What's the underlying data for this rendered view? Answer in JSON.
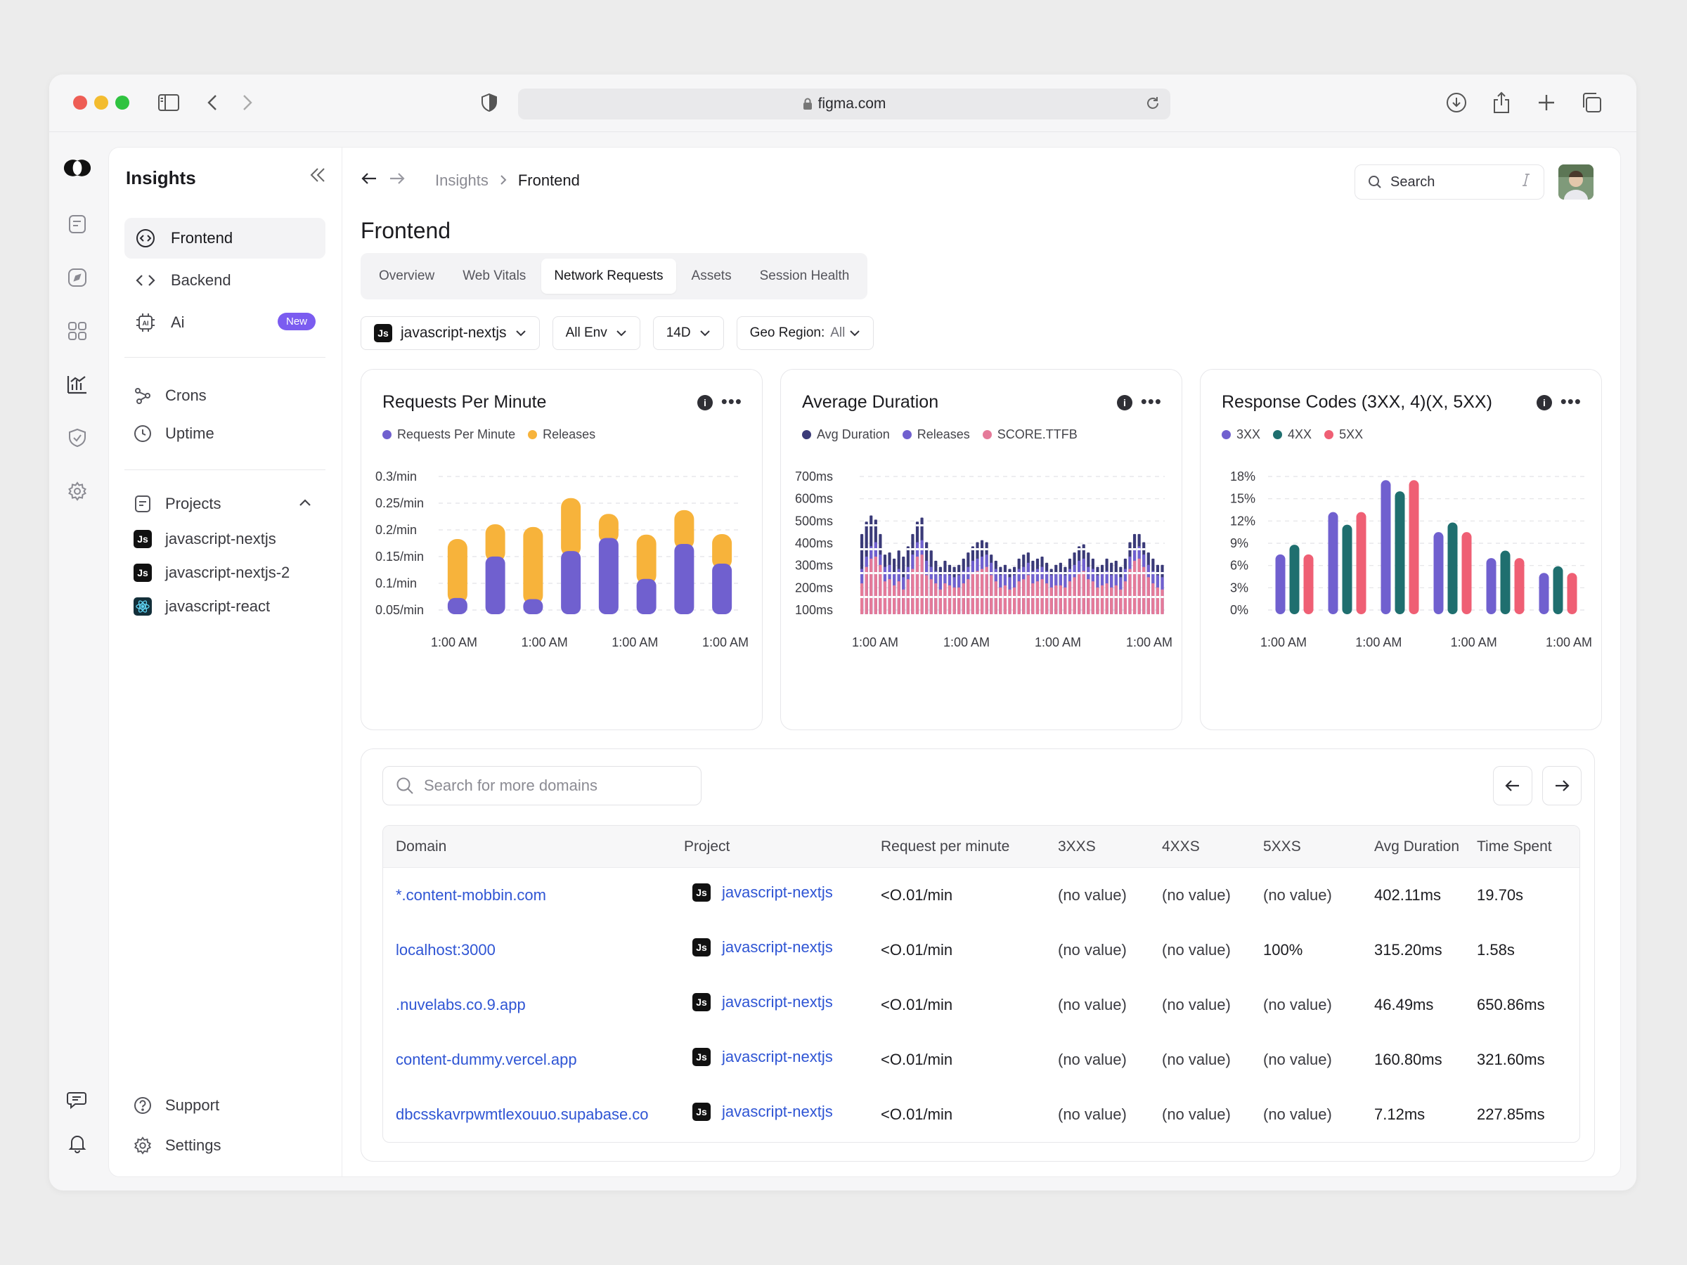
{
  "browser": {
    "url": "figma.com"
  },
  "sidebar": {
    "title": "Insights",
    "nav": [
      {
        "label": "Frontend",
        "icon": "code-circle-icon"
      },
      {
        "label": "Backend",
        "icon": "code-icon"
      },
      {
        "label": "Ai",
        "icon": "ai-chip-icon",
        "badge": "New"
      }
    ],
    "tools": [
      {
        "label": "Crons",
        "icon": "crons-icon"
      },
      {
        "label": "Uptime",
        "icon": "clock-icon"
      }
    ],
    "projects_label": "Projects",
    "projects": [
      "javascript-nextjs",
      "javascript-nextjs-2",
      "javascript-react"
    ],
    "footer": [
      {
        "label": "Support",
        "icon": "help-icon"
      },
      {
        "label": "Settings",
        "icon": "gear-icon"
      }
    ]
  },
  "header": {
    "breadcrumb": [
      "Insights",
      "Frontend"
    ],
    "search_placeholder": "Search",
    "page_title": "Frontend",
    "tabs": [
      "Overview",
      "Web Vitals",
      "Network Requests",
      "Assets",
      "Session Health"
    ],
    "active_tab": "Network Requests"
  },
  "filters": {
    "project_badge": "Js",
    "project": "javascript-nextjs",
    "env": "All Env",
    "range": "14D",
    "geo_label": "Geo Region:",
    "geo_value": "All"
  },
  "charts": {
    "rpm": {
      "title": "Requests Per Minute",
      "legend": [
        "Requests Per Minute",
        "Releases"
      ]
    },
    "avg": {
      "title": "Average Duration",
      "legend": [
        "Avg Duration",
        "Releases",
        "SCORE.TTFB"
      ]
    },
    "codes": {
      "title": "Response Codes (3XX, 4)(X, 5XX)",
      "legend": [
        "3XX",
        "4XX",
        "5XX"
      ]
    }
  },
  "colors": {
    "purple": "#7060cf",
    "orange": "#f7b33b",
    "navy": "#3a3a78",
    "pink": "#e57a99",
    "teal": "#1f6f6f",
    "red": "#ef5f74",
    "link": "#2f55d4"
  },
  "chart_data": [
    {
      "type": "bar",
      "title": "Requests Per Minute",
      "stacked": true,
      "categories": [
        "1:00 AM",
        "1:00 AM",
        "1:00 AM",
        "1:00 AM",
        "1:00 AM",
        "1:00 AM",
        "1:00 AM",
        "1:00 AM"
      ],
      "x_tick_labels": [
        "1:00 AM",
        "1:00 AM",
        "1:00 AM",
        "1:00 AM"
      ],
      "y_tick_labels": [
        "0.3/min",
        "0.25/min",
        "0.2/min",
        "0.15/min",
        "0.1/min",
        "0.05/min"
      ],
      "ylim": [
        0.05,
        0.3
      ],
      "series": [
        {
          "name": "Requests Per Minute",
          "values": [
            0.062,
            0.138,
            0.06,
            0.148,
            0.172,
            0.097,
            0.161,
            0.125
          ]
        },
        {
          "name": "Releases",
          "values": [
            0.17,
            0.197,
            0.192,
            0.245,
            0.216,
            0.178,
            0.223,
            0.179
          ]
        }
      ]
    },
    {
      "type": "bar",
      "title": "Average Duration",
      "x_tick_labels": [
        "1:00 AM",
        "1:00 AM",
        "1:00 AM",
        "1:00 AM"
      ],
      "y_tick_labels": [
        "700ms",
        "600ms",
        "500ms",
        "400ms",
        "300ms",
        "200ms",
        "100ms"
      ],
      "ylim": [
        100,
        700
      ],
      "series": [
        {
          "name": "Avg Duration",
          "values": [
            180,
            260,
            300,
            310,
            270,
            190,
            200,
            170,
            190,
            150,
            200,
            250,
            310,
            320,
            220,
            200,
            180,
            150,
            180,
            170,
            160,
            160,
            180,
            200,
            230,
            240,
            250,
            260,
            220,
            190,
            160,
            170,
            150,
            160,
            190,
            200,
            220,
            180,
            190,
            200,
            180,
            160,
            170,
            170,
            160,
            190,
            210,
            230,
            240,
            200,
            190,
            160,
            170,
            180,
            160,
            170,
            150,
            190,
            250,
            290,
            300,
            260,
            210,
            180,
            160,
            150
          ]
        },
        {
          "name": "Releases",
          "values": [
            250,
            310,
            360,
            380,
            320,
            260,
            270,
            230,
            250,
            210,
            260,
            320,
            380,
            390,
            290,
            260,
            240,
            220,
            230,
            220,
            210,
            220,
            240,
            260,
            290,
            300,
            310,
            320,
            280,
            250,
            220,
            230,
            210,
            220,
            250,
            260,
            280,
            240,
            250,
            260,
            240,
            220,
            230,
            230,
            220,
            250,
            270,
            290,
            300,
            260,
            250,
            220,
            230,
            240,
            220,
            230,
            210,
            250,
            310,
            350,
            360,
            320,
            270,
            240,
            220,
            210
          ]
        },
        {
          "name": "SCORE.TTFB",
          "values": [
            420,
            480,
            510,
            490,
            420,
            320,
            330,
            300,
            340,
            310,
            360,
            420,
            480,
            500,
            380,
            340,
            290,
            260,
            290,
            270,
            260,
            270,
            300,
            330,
            360,
            380,
            390,
            380,
            320,
            290,
            260,
            270,
            250,
            260,
            300,
            320,
            330,
            290,
            300,
            310,
            280,
            250,
            270,
            280,
            260,
            300,
            330,
            360,
            370,
            330,
            300,
            260,
            270,
            300,
            280,
            290,
            260,
            300,
            380,
            420,
            420,
            380,
            330,
            300,
            270,
            270
          ]
        }
      ]
    },
    {
      "type": "bar",
      "title": "Response Codes (3XX, 4)(X, 5XX)",
      "categories": [
        "1:00 AM",
        "1:00 AM",
        "1:00 AM",
        "1:00 AM",
        "1:00 AM",
        "1:00 AM"
      ],
      "x_tick_labels": [
        "1:00 AM",
        "1:00 AM",
        "1:00 AM",
        "1:00 AM"
      ],
      "y_tick_labels": [
        "18%",
        "15%",
        "12%",
        "9%",
        "6%",
        "3%",
        "0%"
      ],
      "ylim": [
        0,
        18
      ],
      "series": [
        {
          "name": "3XX",
          "values": [
            7.5,
            13.2,
            17.5,
            10.5,
            7.0,
            5.0
          ]
        },
        {
          "name": "4XX",
          "values": [
            8.8,
            11.5,
            16.0,
            11.8,
            8.0,
            5.9
          ]
        },
        {
          "name": "5XX",
          "values": [
            7.5,
            13.2,
            17.5,
            10.5,
            7.0,
            5.0
          ]
        }
      ]
    }
  ],
  "table": {
    "search_placeholder": "Search for more domains",
    "columns": [
      "Domain",
      "Project",
      "Request per minute",
      "3XXS",
      "4XXS",
      "5XXS",
      "Avg Duration",
      "Time Spent"
    ],
    "rows": [
      {
        "domain": "*.content-mobbin.com",
        "project": "javascript-nextjs",
        "rpm": "<O.01/min",
        "c3": "(no value)",
        "c4": "(no value)",
        "c5": "(no value)",
        "avg": "402.11ms",
        "time": "19.70s"
      },
      {
        "domain": "localhost:3000",
        "project": "javascript-nextjs",
        "rpm": "<O.01/min",
        "c3": "(no value)",
        "c4": "(no value)",
        "c5": "100%",
        "avg": "315.20ms",
        "time": "1.58s"
      },
      {
        "domain": ".nuvelabs.co.9.app",
        "project": "javascript-nextjs",
        "rpm": "<O.01/min",
        "c3": "(no value)",
        "c4": "(no value)",
        "c5": "(no value)",
        "avg": "46.49ms",
        "time": "650.86ms"
      },
      {
        "domain": "content-dummy.vercel.app",
        "project": "javascript-nextjs",
        "rpm": "<O.01/min",
        "c3": "(no value)",
        "c4": "(no value)",
        "c5": "(no value)",
        "avg": "160.80ms",
        "time": "321.60ms"
      },
      {
        "domain": "dbcsskavrpwmtlexouuo.supabase.co",
        "project": "javascript-nextjs",
        "rpm": "<O.01/min",
        "c3": "(no value)",
        "c4": "(no value)",
        "c5": "(no value)",
        "avg": "7.12ms",
        "time": "227.85ms"
      }
    ]
  }
}
